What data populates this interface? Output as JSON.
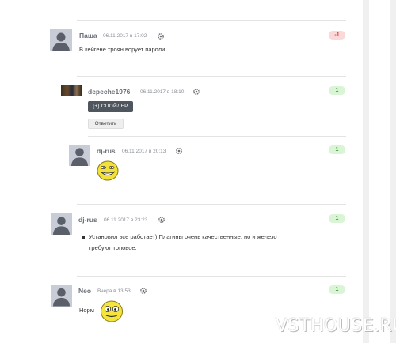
{
  "comments": [
    {
      "author": "Паша",
      "date": "06.11.2017 в 17:02",
      "rating": "-1",
      "text": "В кейгене троян ворует пароли"
    },
    {
      "author": "depeche1976",
      "date": "06.11.2017 в 18:10",
      "rating": "1",
      "spoiler_label": "[+] СПОЙЛЕР",
      "reply_label": "Ответить"
    },
    {
      "author": "dj-rus",
      "date": "06.11.2017 в 20:13",
      "rating": "1",
      "smiley": "troll-face-smiley"
    },
    {
      "author": "dj-rus",
      "date": "06.11.2017 в 23:23",
      "rating": "1",
      "text_line1": "Установил все работает) Плагины очень качественные, но и железо",
      "text_line2": "требуют топовое."
    },
    {
      "author": "Neo",
      "date": "Вчера в 13:53",
      "rating": "1",
      "text": "Норм",
      "smiley": "smile-smiley"
    }
  ],
  "watermark": "VSTHOUSE.RU",
  "icons": {
    "settings": "gear-icon",
    "avatar_default": "default-avatar-icon"
  },
  "colors": {
    "positive_bg": "#d9f5d5",
    "positive_text": "#3b8b32",
    "negative_bg": "#fbd9d9",
    "negative_text": "#d23a3a",
    "spoiler_bg": "#4f565e"
  }
}
